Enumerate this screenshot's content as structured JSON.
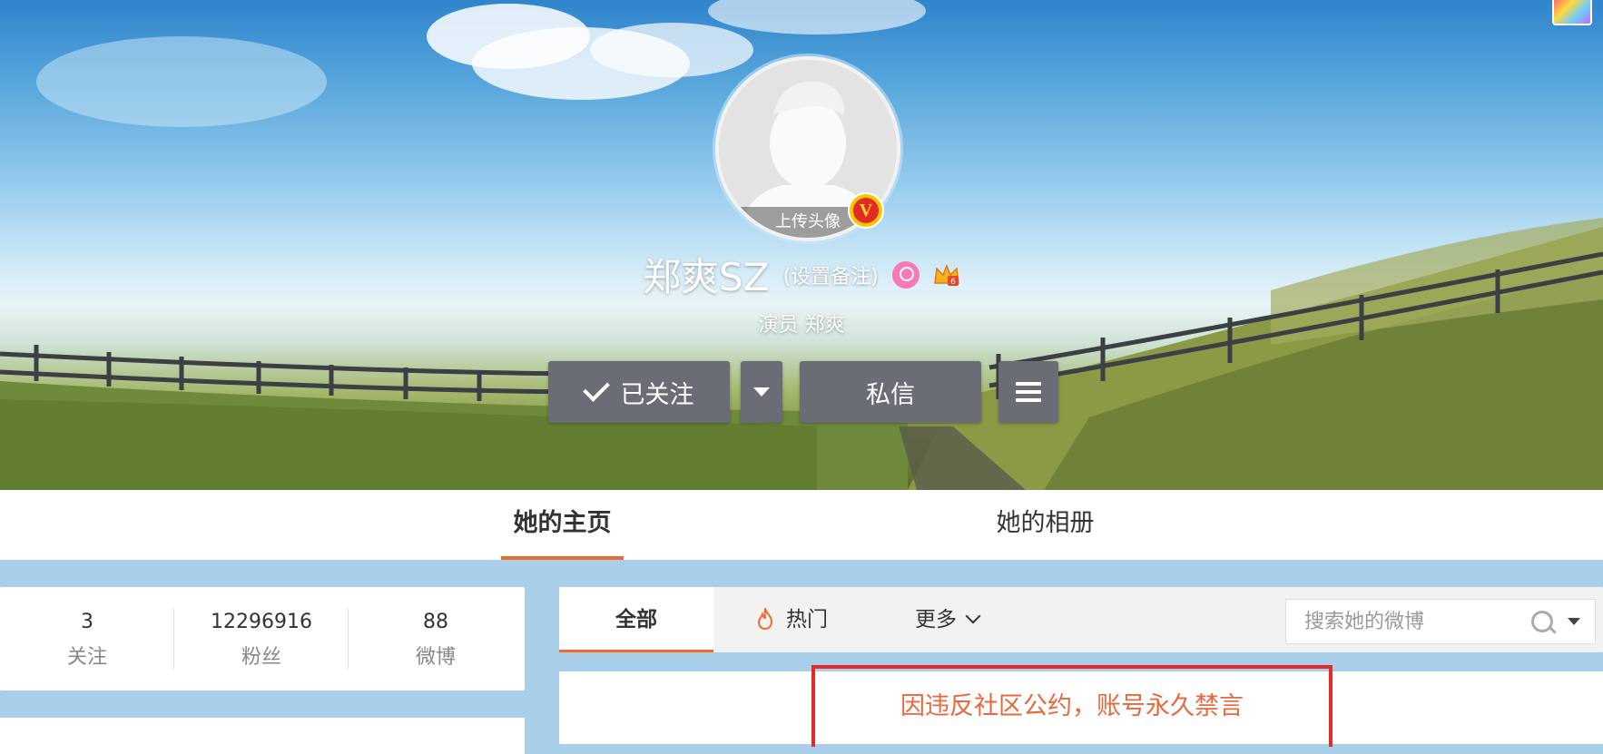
{
  "profile": {
    "avatar_upload_label": "上传头像",
    "nickname": "郑爽SZ",
    "remark_link": "(设置备注)",
    "tagline": "演员 郑爽",
    "verified_badge": "V",
    "gender_icon": "female-icon",
    "member_icon": "crown-icon"
  },
  "actions": {
    "follow_label": "已关注",
    "message_label": "私信",
    "dropdown_icon": "caret-down-icon",
    "menu_icon": "hamburger-icon"
  },
  "nav": {
    "tabs": [
      {
        "label": "她的主页",
        "active": true
      },
      {
        "label": "她的相册",
        "active": false
      }
    ],
    "accent": "#ef6a2d"
  },
  "stats": [
    {
      "value": "3",
      "label": "关注"
    },
    {
      "value": "12296916",
      "label": "粉丝"
    },
    {
      "value": "88",
      "label": "微博"
    }
  ],
  "feed": {
    "tabs": [
      {
        "label": "全部",
        "active": true
      },
      {
        "label": "热门",
        "icon": "fire-icon"
      },
      {
        "label": "更多",
        "icon": "chevron-down-icon"
      }
    ],
    "search_placeholder": "搜索她的微博"
  },
  "notice": {
    "text": "因违反社区公约，账号永久禁言",
    "text_color": "#e8683d",
    "frame_color": "#e52a2a"
  }
}
